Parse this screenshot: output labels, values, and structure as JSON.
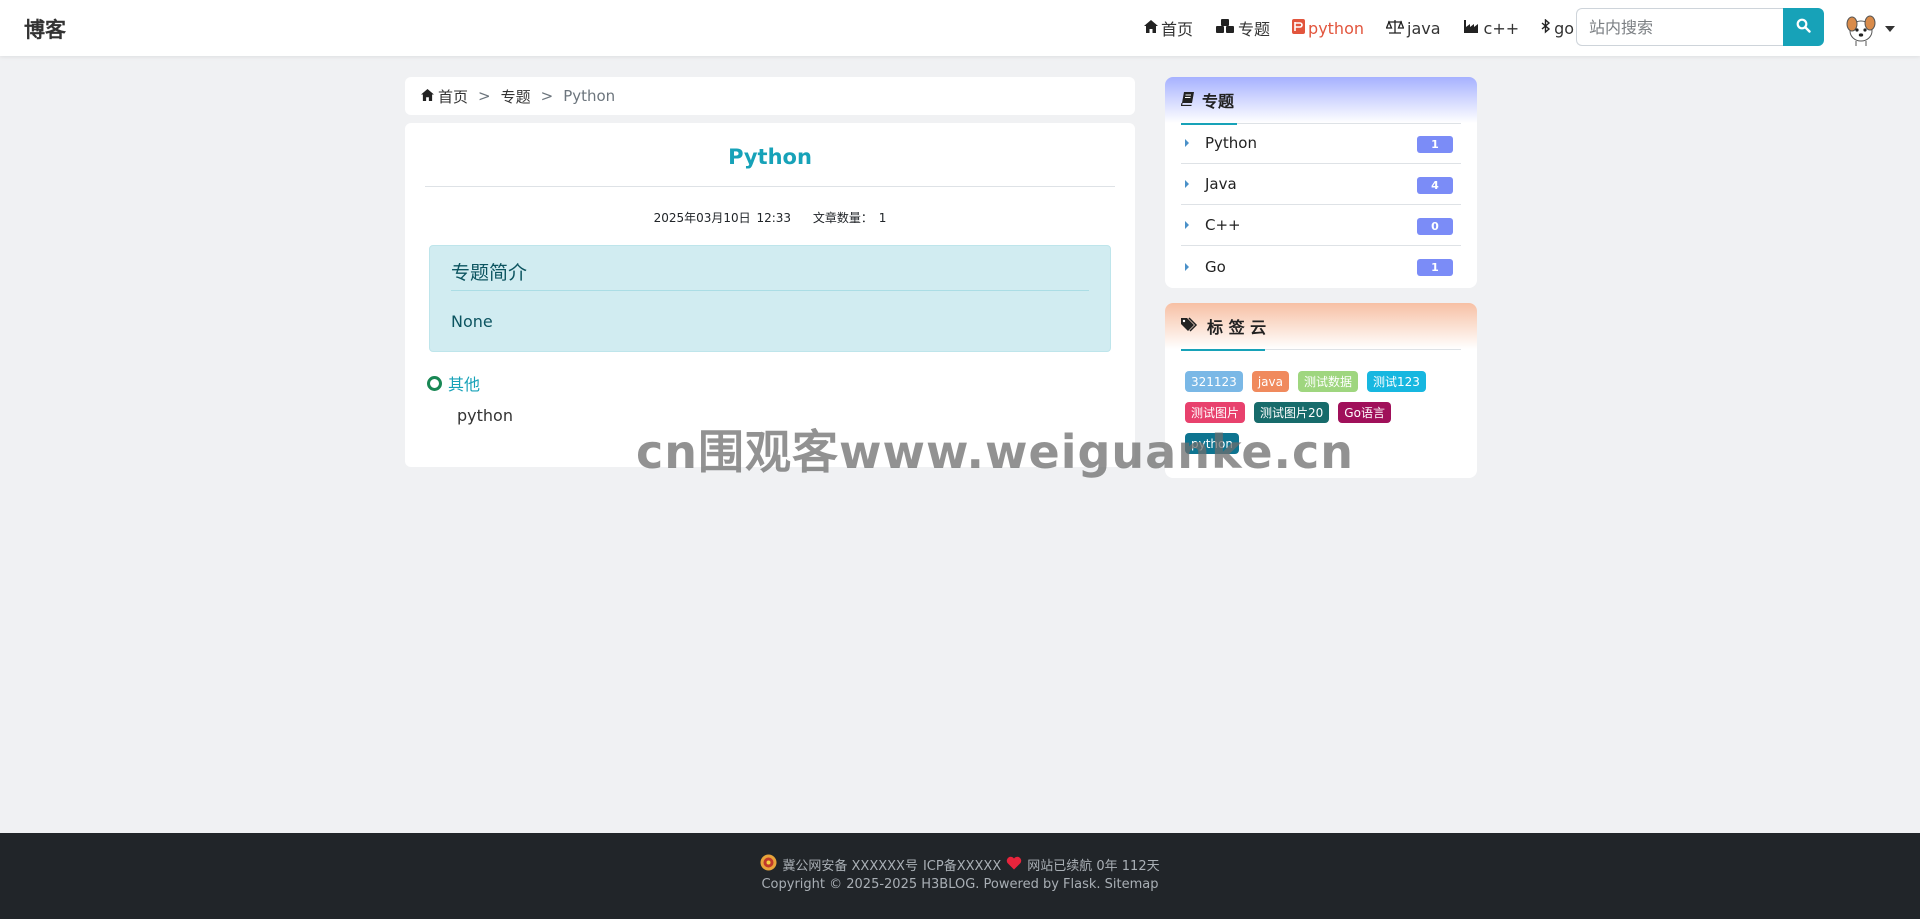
{
  "nav": {
    "brand": "博客",
    "items": [
      {
        "label": "首页",
        "icon": "home-icon"
      },
      {
        "label": "专题",
        "icon": "cubes-icon"
      },
      {
        "label": "python",
        "icon": "python-icon",
        "active": true
      },
      {
        "label": "java",
        "icon": "balance-scale-icon"
      },
      {
        "label": "c++",
        "icon": "industry-icon"
      },
      {
        "label": "go",
        "icon": "bluetooth-icon"
      }
    ],
    "search": {
      "placeholder": "站内搜索",
      "value": ""
    },
    "colors": {
      "active": "#e2553d",
      "search_button": "#17a2b8"
    }
  },
  "breadcrumb": {
    "home": "首页",
    "section": "专题",
    "current": "Python",
    "separator": ">"
  },
  "topic": {
    "title": "Python",
    "date": "2025年03月10日 12:33",
    "article_count_label": "文章数量：",
    "article_count": "1",
    "intro_heading": "专题简介",
    "intro_body": "None",
    "group_label": "其他",
    "articles": [
      "python"
    ]
  },
  "sidebar": {
    "topics_title": "专题",
    "topics": [
      {
        "name": "Python",
        "count": "1"
      },
      {
        "name": "Java",
        "count": "4"
      },
      {
        "name": "C++",
        "count": "0"
      },
      {
        "name": "Go",
        "count": "1"
      }
    ],
    "tags_title": "标 签 云",
    "tags": [
      {
        "label": "321123",
        "color": "#7ab8e6"
      },
      {
        "label": "java",
        "color": "#f08a5d"
      },
      {
        "label": "测试数据",
        "color": "#9fd67f"
      },
      {
        "label": "测试123",
        "color": "#17b7e0"
      },
      {
        "label": "测试图片",
        "color": "#e8416d"
      },
      {
        "label": "测试图片20",
        "color": "#176b6b"
      },
      {
        "label": "Go语言",
        "color": "#a0105a"
      },
      {
        "label": "python",
        "color": "#0e7490"
      }
    ]
  },
  "watermark": "cn围观客www.weiguanke.cn",
  "footer": {
    "police": "冀公网安备 XXXXXX号",
    "icp": "ICP备XXXXX",
    "uptime": "网站已续航 0年 112天",
    "copyright": "Copyright © 2025-2025 H3BLOG. Powered by Flask.",
    "sitemap": "Sitemap"
  }
}
